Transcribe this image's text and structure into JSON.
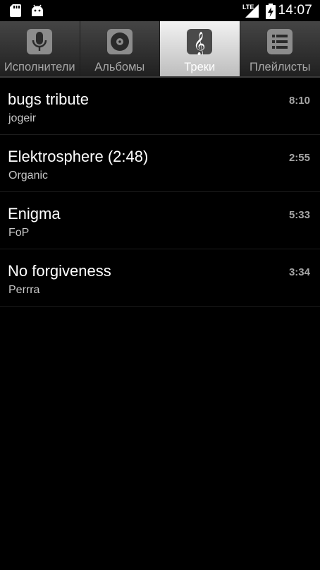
{
  "status_bar": {
    "network_label": "LTE",
    "time": "14:07"
  },
  "tabs": [
    {
      "label": "Исполнители",
      "icon": "microphone-icon",
      "selected": false
    },
    {
      "label": "Альбомы",
      "icon": "album-disc-icon",
      "selected": false
    },
    {
      "label": "Треки",
      "icon": "treble-clef-icon",
      "selected": true
    },
    {
      "label": "Плейлисты",
      "icon": "playlist-icon",
      "selected": false
    }
  ],
  "tracks": [
    {
      "title": "bugs tribute",
      "artist": "jogeir",
      "duration": "8:10"
    },
    {
      "title": "Elektrosphere (2:48)",
      "artist": "Organic",
      "duration": "2:55"
    },
    {
      "title": "Enigma",
      "artist": "FoP",
      "duration": "5:33"
    },
    {
      "title": "No forgiveness",
      "artist": "Perrra",
      "duration": "3:34"
    }
  ],
  "colors": {
    "background": "#000000",
    "selected_tab": "#e0e0e0",
    "unselected_tab": "#353535",
    "secondary_text": "#a6a6a6"
  }
}
